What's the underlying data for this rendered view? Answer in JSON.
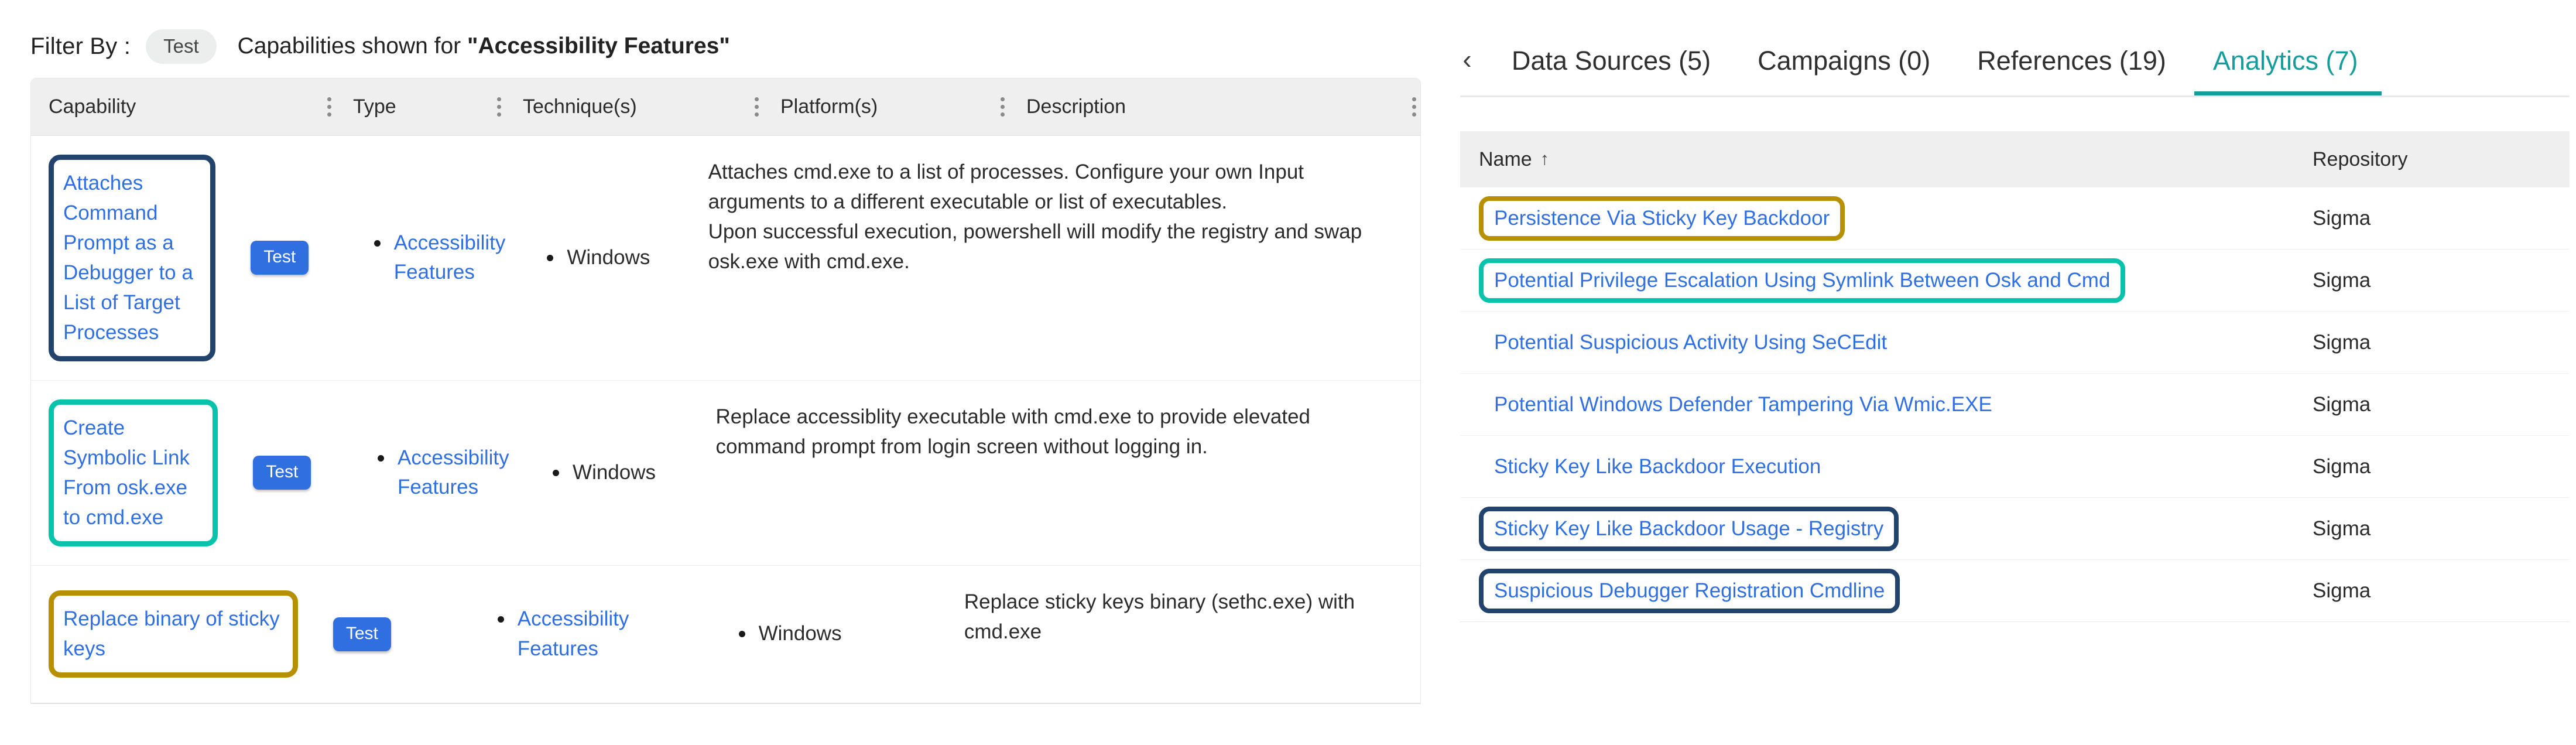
{
  "left": {
    "filter": {
      "label": "Filter By :",
      "chip": "Test",
      "note_prefix": "Capabilities shown for ",
      "note_target": "\"Accessibility Features\""
    },
    "table": {
      "columns": [
        {
          "key": "capability",
          "label": "Capability"
        },
        {
          "key": "type",
          "label": "Type"
        },
        {
          "key": "techniques",
          "label": "Technique(s)"
        },
        {
          "key": "platforms",
          "label": "Platform(s)"
        },
        {
          "key": "description",
          "label": "Description"
        }
      ],
      "rows": [
        {
          "capability": "Attaches Command Prompt as a Debugger to a List of Target Processes",
          "capability_highlight": "navy",
          "type": "Test",
          "technique": "Accessibility Features",
          "platform": "Windows",
          "description": "Attaches cmd.exe to a list of processes. Configure your own Input arguments to a different executable or list of executables.\nUpon successful execution, powershell will modify the registry and swap osk.exe with cmd.exe."
        },
        {
          "capability": "Create Symbolic Link From osk.exe to cmd.exe",
          "capability_highlight": "teal",
          "type": "Test",
          "technique": "Accessibility Features",
          "platform": "Windows",
          "description": "Replace accessiblity executable with cmd.exe to provide elevated command prompt from login screen without logging in."
        },
        {
          "capability": "Replace binary of sticky keys",
          "capability_highlight": "gold",
          "type": "Test",
          "technique": "Accessibility Features",
          "platform": "Windows",
          "description": "Replace sticky keys binary (sethc.exe) with cmd.exe"
        }
      ]
    }
  },
  "right": {
    "back_icon": "‹",
    "tabs": [
      {
        "label": "Data Sources (5)",
        "active": false
      },
      {
        "label": "Campaigns (0)",
        "active": false
      },
      {
        "label": "References (19)",
        "active": false
      },
      {
        "label": "Analytics (7)",
        "active": true
      }
    ],
    "table": {
      "columns": [
        {
          "key": "name",
          "label": "Name",
          "sort": "↑"
        },
        {
          "key": "repository",
          "label": "Repository"
        }
      ],
      "rows": [
        {
          "name": "Persistence Via Sticky Key Backdoor",
          "repository": "Sigma",
          "highlight": "gold"
        },
        {
          "name": "Potential Privilege Escalation Using Symlink Between Osk and Cmd",
          "repository": "Sigma",
          "highlight": "teal"
        },
        {
          "name": "Potential Suspicious Activity Using SeCEdit",
          "repository": "Sigma",
          "highlight": "none"
        },
        {
          "name": "Potential Windows Defender Tampering Via Wmic.EXE",
          "repository": "Sigma",
          "highlight": "none"
        },
        {
          "name": "Sticky Key Like Backdoor Execution",
          "repository": "Sigma",
          "highlight": "none"
        },
        {
          "name": "Sticky Key Like Backdoor Usage - Registry",
          "repository": "Sigma",
          "highlight": "navy"
        },
        {
          "name": "Suspicious Debugger Registration Cmdline",
          "repository": "Sigma",
          "highlight": "navy"
        }
      ]
    }
  },
  "colors": {
    "link": "#2f6fe0",
    "badge": "#2f6fe0",
    "tab_active": "#159c9c",
    "highlight_navy": "#22436b",
    "highlight_teal": "#07c3ab",
    "highlight_gold": "#b79000",
    "header_bg": "#efefef"
  }
}
